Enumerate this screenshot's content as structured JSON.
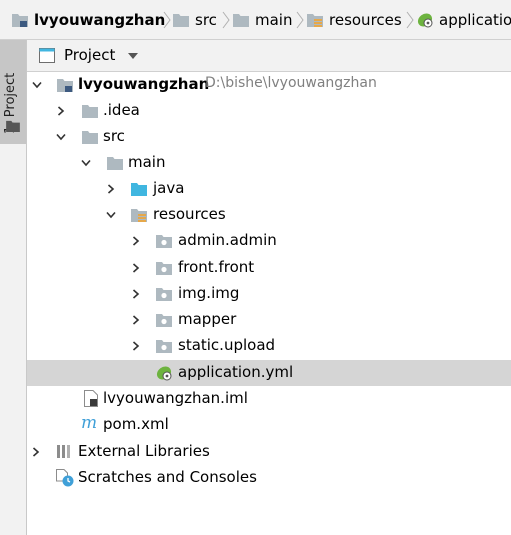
{
  "breadcrumb": {
    "items": [
      {
        "label": "lvyouwangzhan",
        "icon": "module-folder-icon"
      },
      {
        "label": "src",
        "icon": "folder-icon"
      },
      {
        "label": "main",
        "icon": "folder-icon"
      },
      {
        "label": "resources",
        "icon": "resources-folder-icon"
      },
      {
        "label": "application.yml",
        "icon": "spring-leaf-icon"
      }
    ]
  },
  "toolwindow_strip": {
    "tab_label": "1: Project"
  },
  "panel": {
    "title": "Project",
    "dropdown_icon": "caret-down-icon"
  },
  "tree": {
    "root": {
      "name": "lvyouwangzhan",
      "path": "D:\\bishe\\lvyouwangzhan",
      "expanded": true
    },
    "idea": {
      "name": ".idea",
      "expanded": false
    },
    "src": {
      "name": "src",
      "expanded": true
    },
    "main": {
      "name": "main",
      "expanded": true
    },
    "java": {
      "name": "java",
      "expanded": false
    },
    "resources": {
      "name": "resources",
      "expanded": true
    },
    "admin": {
      "name": "admin.admin",
      "expanded": false
    },
    "front": {
      "name": "front.front",
      "expanded": false
    },
    "img": {
      "name": "img.img",
      "expanded": false
    },
    "mapper": {
      "name": "mapper",
      "expanded": false
    },
    "static": {
      "name": "static.upload",
      "expanded": false
    },
    "application": {
      "name": "application.yml",
      "selected": true
    },
    "iml": {
      "name": "lvyouwangzhan.iml"
    },
    "pom": {
      "name": "pom.xml"
    },
    "external": {
      "name": "External Libraries",
      "expanded": false
    },
    "scratches": {
      "name": "Scratches and Consoles"
    }
  },
  "colors": {
    "selection": "#d5d5d5",
    "folder": "#aeb9c0",
    "source_folder": "#40b6e0",
    "spring_green": "#6db33f",
    "muted_text": "#808080"
  }
}
